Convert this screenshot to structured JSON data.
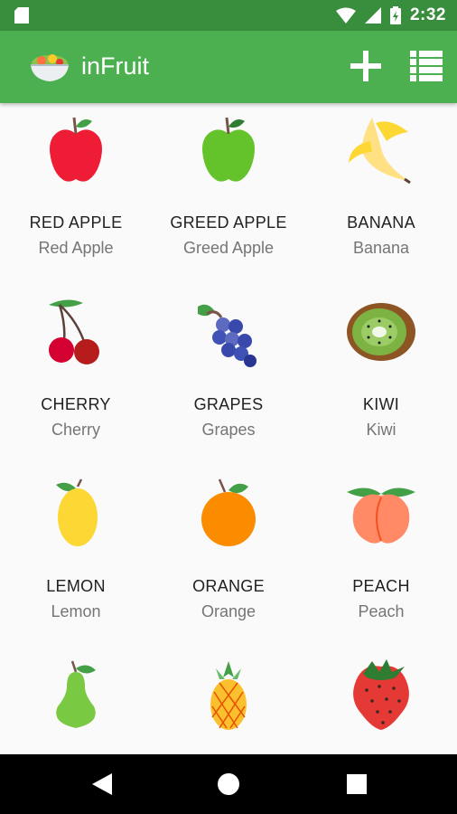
{
  "status_bar": {
    "time": "2:32"
  },
  "app_bar": {
    "title": "inFruit"
  },
  "fruits": [
    {
      "name": "RED APPLE",
      "sub": "Red Apple",
      "icon": "red-apple-icon"
    },
    {
      "name": "GREED APPLE",
      "sub": "Greed Apple",
      "icon": "green-apple-icon"
    },
    {
      "name": "BANANA",
      "sub": "Banana",
      "icon": "banana-icon"
    },
    {
      "name": "CHERRY",
      "sub": "Cherry",
      "icon": "cherry-icon"
    },
    {
      "name": "GRAPES",
      "sub": "Grapes",
      "icon": "grapes-icon"
    },
    {
      "name": "KIWI",
      "sub": "Kiwi",
      "icon": "kiwi-icon"
    },
    {
      "name": "LEMON",
      "sub": "Lemon",
      "icon": "lemon-icon"
    },
    {
      "name": "ORANGE",
      "sub": "Orange",
      "icon": "orange-icon"
    },
    {
      "name": "PEACH",
      "sub": "Peach",
      "icon": "peach-icon"
    },
    {
      "name": "",
      "sub": "",
      "icon": "pear-icon"
    },
    {
      "name": "",
      "sub": "",
      "icon": "pineapple-icon"
    },
    {
      "name": "",
      "sub": "",
      "icon": "strawberry-icon"
    }
  ],
  "colors": {
    "primary": "#4caf50",
    "primary_dark": "#388e3c"
  }
}
